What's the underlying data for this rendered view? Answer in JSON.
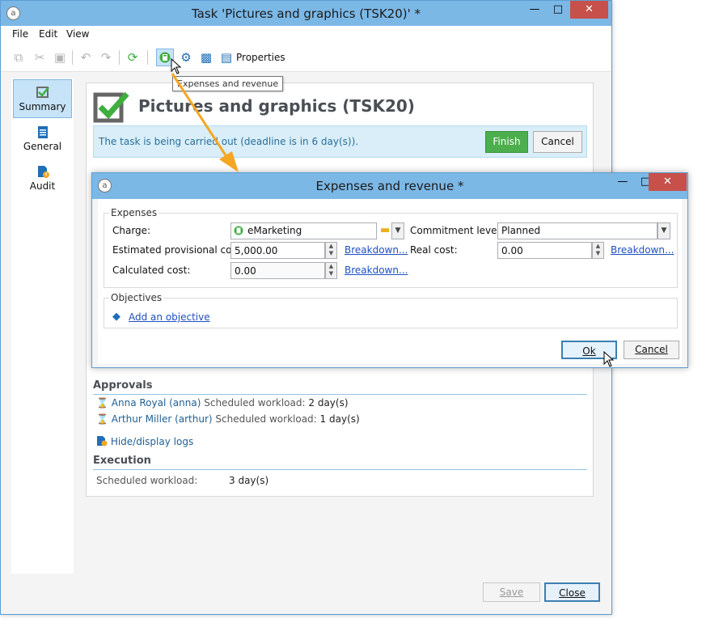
{
  "window": {
    "title": "Task 'Pictures and graphics (TSK20)' *",
    "app_icon": "ac-logo-icon"
  },
  "menu": [
    "File",
    "Edit",
    "View"
  ],
  "toolbar": {
    "properties_label": "Properties",
    "tooltip": "Expenses and revenue"
  },
  "nav": [
    {
      "label": "Summary",
      "icon": "summary-icon"
    },
    {
      "label": "General",
      "icon": "general-icon"
    },
    {
      "label": "Audit",
      "icon": "audit-icon"
    }
  ],
  "task": {
    "title": "Pictures and graphics (TSK20)",
    "status": "The task is being carried out (deadline is in 6 day(s)).",
    "finish_label": "Finish",
    "cancel_label": "Cancel"
  },
  "dialog": {
    "title": "Expenses and revenue *",
    "expenses_legend": "Expenses",
    "charge_label": "Charge:",
    "charge_value": "eMarketing",
    "commitment_label": "Commitment level:",
    "commitment_value": "Planned",
    "est_cost_label": "Estimated provisional cost:",
    "est_cost_value": "5,000.00",
    "real_cost_label": "Real cost:",
    "real_cost_value": "0.00",
    "calc_cost_label": "Calculated cost:",
    "calc_cost_value": "0.00",
    "breakdown_label": "Breakdown...",
    "objectives_legend": "Objectives",
    "add_objective_label": "Add an objective",
    "ok_label": "Ok",
    "cancel_label": "Cancel"
  },
  "approvals": {
    "heading": "Approvals",
    "rows": [
      {
        "name": "Anna Royal (anna)",
        "workload_label": "Scheduled workload:",
        "workload": "2 day(s)"
      },
      {
        "name": "Arthur Miller (arthur)",
        "workload_label": "Scheduled workload:",
        "workload": "1 day(s)"
      }
    ],
    "logs_label": "Hide/display logs"
  },
  "execution": {
    "heading": "Execution",
    "workload_label": "Scheduled workload:",
    "workload_value": "3 day(s)"
  },
  "footer": {
    "save_label": "Save",
    "close_label": "Close"
  },
  "colors": {
    "accent": "#7cb8e6",
    "finish_green": "#4cae4c",
    "arrow": "#f5a623"
  }
}
